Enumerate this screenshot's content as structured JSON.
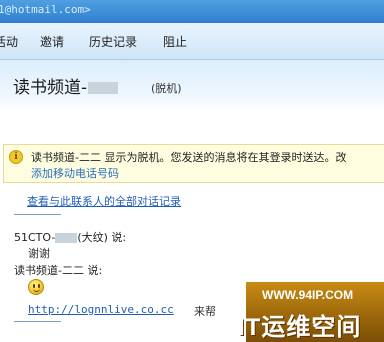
{
  "window": {
    "email": "1@hotmail.com>"
  },
  "menu": {
    "items": [
      {
        "key": "activity",
        "label": "活动"
      },
      {
        "key": "invite",
        "label": "邀请"
      },
      {
        "key": "history",
        "label": "历史记录"
      },
      {
        "key": "block",
        "label": "阻止"
      }
    ]
  },
  "contact": {
    "name": "读书频道-",
    "status": "(脱机)"
  },
  "info_bar": {
    "icon": "info-icon",
    "text": "读书频道-二二 显示为脱机。您发送的消息将在其登录时送达。改",
    "link": "添加移动电话号码"
  },
  "history_link": "查看与此联系人的全部对话记录",
  "messages": [
    {
      "sender": "51CTO-",
      "sender_suffix": "(大纹) 说:",
      "body": "谢谢"
    },
    {
      "sender": "读书频道-二二 说:",
      "body_icon": "smiley-icon"
    }
  ],
  "shared_link": {
    "url": "http://lognnlive.co.cc",
    "tail": "来帮"
  },
  "watermark": {
    "url": "WWW.94IP.COM",
    "title": "IT运维空间"
  },
  "colors": {
    "link": "#1f5db8",
    "menu_bg": "#d9ecfa",
    "info_bg": "#fffde0",
    "watermark_bg": "#a76d0d"
  }
}
